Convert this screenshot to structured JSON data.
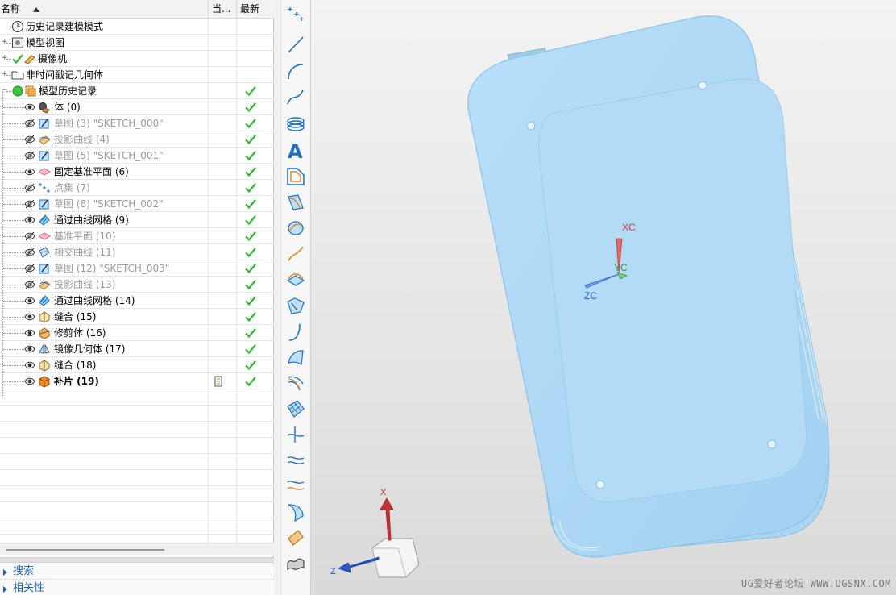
{
  "navigator": {
    "headers": {
      "name": "名称",
      "current": "当...",
      "latest": "最新"
    },
    "rows": [
      {
        "label": "历史记录建模模式",
        "icon": "clock-icon",
        "style": "normal",
        "latest": false
      },
      {
        "label": "模型视图",
        "icon": "model-view-icon",
        "style": "normal",
        "latest": false
      },
      {
        "label": "摄像机",
        "icon": "camera-icon",
        "style": "normal",
        "latest": false
      },
      {
        "label": "非时间戳记几何体",
        "icon": "folder-icon",
        "style": "normal",
        "latest": false
      },
      {
        "label": "模型历史记录",
        "icon": "model-history-icon",
        "style": "normal",
        "latest": true
      },
      {
        "label": "体 (0)",
        "icon": "body-icon",
        "style": "normal",
        "latest": true
      },
      {
        "label": "草图 (3) \"SKETCH_000\"",
        "icon": "sketch-icon",
        "style": "gray",
        "latest": true
      },
      {
        "label": "投影曲线 (4)",
        "icon": "projected-curve-icon",
        "style": "gray",
        "latest": true
      },
      {
        "label": "草图 (5) \"SKETCH_001\"",
        "icon": "sketch-icon",
        "style": "gray",
        "latest": true
      },
      {
        "label": "固定基准平面 (6)",
        "icon": "datum-plane-icon",
        "style": "normal",
        "latest": true
      },
      {
        "label": "点集 (7)",
        "icon": "point-set-icon",
        "style": "gray",
        "latest": true
      },
      {
        "label": "草图 (8) \"SKETCH_002\"",
        "icon": "sketch-icon",
        "style": "gray",
        "latest": true
      },
      {
        "label": "通过曲线网格 (9)",
        "icon": "curve-mesh-icon",
        "style": "normal",
        "latest": true
      },
      {
        "label": "基准平面 (10)",
        "icon": "datum-plane-icon",
        "style": "gray",
        "latest": true
      },
      {
        "label": "相交曲线 (11)",
        "icon": "intersect-curve-icon",
        "style": "gray",
        "latest": true
      },
      {
        "label": "草图 (12) \"SKETCH_003\"",
        "icon": "sketch-icon",
        "style": "gray",
        "latest": true
      },
      {
        "label": "投影曲线 (13)",
        "icon": "projected-curve-icon",
        "style": "gray",
        "latest": true
      },
      {
        "label": "通过曲线网格 (14)",
        "icon": "curve-mesh-icon",
        "style": "normal",
        "latest": true
      },
      {
        "label": "缝合 (15)",
        "icon": "sew-icon",
        "style": "normal",
        "latest": true
      },
      {
        "label": "修剪体 (16)",
        "icon": "trim-body-icon",
        "style": "normal",
        "latest": true
      },
      {
        "label": "镜像几何体 (17)",
        "icon": "mirror-geometry-icon",
        "style": "normal",
        "latest": true
      },
      {
        "label": "缝合 (18)",
        "icon": "sew-icon",
        "style": "normal",
        "latest": true
      },
      {
        "label": "补片 (19)",
        "icon": "patch-icon",
        "style": "bold",
        "latest": true
      }
    ],
    "panels": [
      {
        "label": "搜索"
      },
      {
        "label": "相关性"
      }
    ]
  },
  "viewport": {
    "wcs_labels": {
      "x": "XC",
      "y": "YC",
      "z": "ZC"
    },
    "triad_labels": {
      "x": "X",
      "z": "Z"
    },
    "watermark": "UG爱好者论坛 WWW.UGSNX.COM"
  },
  "colors": {
    "part": "#a9d6f5",
    "part_edge": "#8fc4ea",
    "check": "#2fb52f",
    "link": "#1e5fa8",
    "axis_x": "#d23c3c",
    "axis_y": "#3a9a3a",
    "axis_z": "#2f5fd0"
  }
}
